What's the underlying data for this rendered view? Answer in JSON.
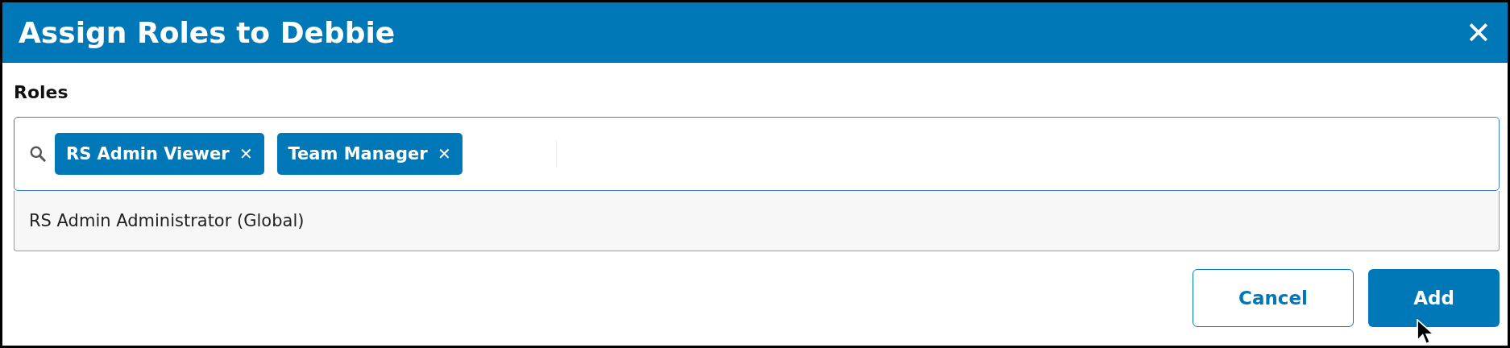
{
  "dialog": {
    "title": "Assign Roles to Debbie",
    "close": "✕"
  },
  "roles_field": {
    "label": "Roles",
    "chips": [
      {
        "label": "RS Admin Viewer",
        "remove": "✕"
      },
      {
        "label": "Team Manager",
        "remove": "✕"
      }
    ]
  },
  "suggestions": [
    {
      "label": "RS Admin Administrator (Global)",
      "selected": false
    }
  ],
  "buttons": [
    {
      "label": "Cancel",
      "kind": "secondary"
    },
    {
      "label": "Add",
      "kind": "primary"
    }
  ]
}
